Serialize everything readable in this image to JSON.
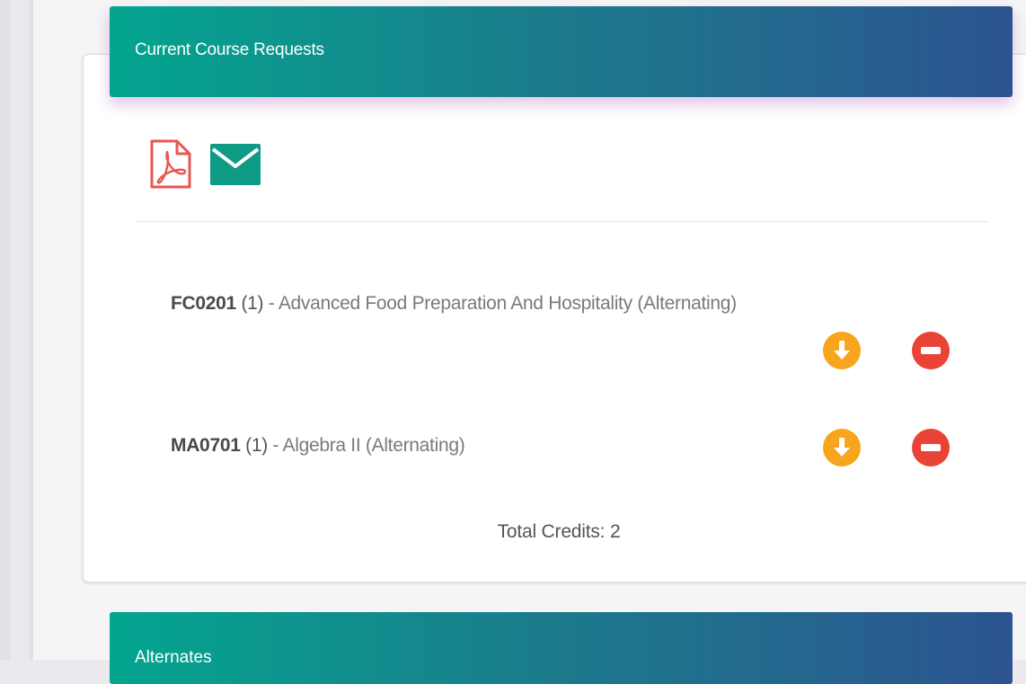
{
  "course_requests": {
    "title": "Current Course Requests",
    "toolbar": {
      "pdf_icon": "pdf-icon",
      "email_icon": "email-icon"
    },
    "courses": [
      {
        "code": "FC0201",
        "credits": "(1)",
        "name": " - Advanced Food Preparation And Hospitality (Alternating)"
      },
      {
        "code": "MA0701",
        "credits": "(1)",
        "name": " - Algebra II (Alternating)"
      }
    ],
    "total_credits_label": "Total Credits: 2"
  },
  "alternates": {
    "title": "Alternates"
  },
  "colors": {
    "header_gradient_start": "#03a58f",
    "header_gradient_end": "#2c5490",
    "pdf_red": "#e8574f",
    "mail_teal": "#0f9a86",
    "move_down_orange": "#f7a51c",
    "remove_red": "#e94335"
  }
}
